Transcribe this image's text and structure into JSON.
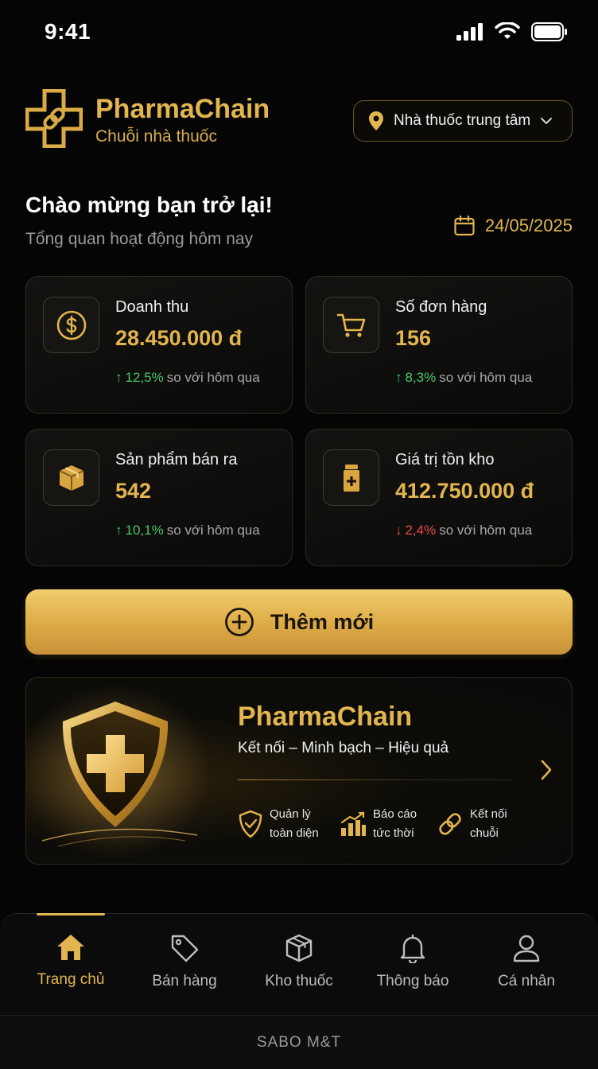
{
  "status_bar": {
    "time": "9:41",
    "icons": [
      "signal-icon",
      "wifi-icon",
      "battery-icon"
    ]
  },
  "header": {
    "brand_name": "PharmaChain",
    "brand_sub": "Chuỗi nhà thuốc",
    "logo_icon": "cross-chain-logo",
    "store_select": {
      "label": "Nhà thuốc trung tâm",
      "icon": "location-pin-icon"
    }
  },
  "welcome": {
    "title": "Chào mừng bạn trở lại!",
    "subtitle": "Tổng quan hoạt động hôm nay",
    "date": "24/05/2025"
  },
  "stats": [
    {
      "label": "Doanh thu",
      "value": "28.450.000 đ",
      "change": "12,5%",
      "direction": "up",
      "compare": "so với hôm qua",
      "icon": "dollar-coin-icon"
    },
    {
      "label": "Số đơn hàng",
      "value": "156",
      "change": "8,3%",
      "direction": "up",
      "compare": "so với hôm qua",
      "icon": "cart-icon"
    },
    {
      "label": "Sản phẩm bán ra",
      "value": "542",
      "change": "10,1%",
      "direction": "up",
      "compare": "so với hôm qua",
      "icon": "box-icon"
    },
    {
      "label": "Giá trị tồn kho",
      "value": "412.750.000 đ",
      "change": "2,4%",
      "direction": "down",
      "compare": "so với hôm qua",
      "icon": "medicine-bottle-icon"
    }
  ],
  "add_button": {
    "label": "Thêm mới"
  },
  "promo": {
    "title": "PharmaChain",
    "tagline": "Kết nối – Minh bạch – Hiệu quả",
    "features": [
      {
        "line1": "Quản lý",
        "line2": "toàn diện",
        "icon": "shield-check-icon"
      },
      {
        "line1": "Báo cáo",
        "line2": "tức thời",
        "icon": "bar-chart-icon"
      },
      {
        "line1": "Kết nối",
        "line2": "chuỗi",
        "icon": "link-icon"
      }
    ]
  },
  "tabs": [
    {
      "label": "Trang chủ",
      "icon": "home-icon",
      "active": true
    },
    {
      "label": "Bán hàng",
      "icon": "tag-icon",
      "active": false
    },
    {
      "label": "Kho thuốc",
      "icon": "package-icon",
      "active": false
    },
    {
      "label": "Thông báo",
      "icon": "bell-icon",
      "active": false
    },
    {
      "label": "Cá nhân",
      "icon": "user-icon",
      "active": false
    }
  ],
  "footer": {
    "text": "SABO M&T"
  },
  "colors": {
    "gold": "#e2b54f",
    "background": "#050505",
    "up": "#48c86a",
    "down": "#e84a4a"
  }
}
